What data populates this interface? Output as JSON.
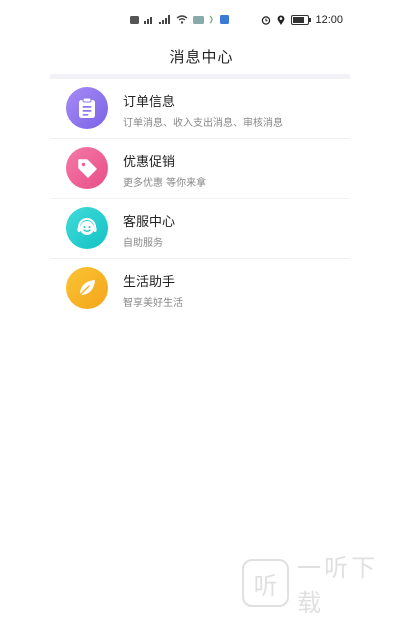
{
  "status_bar": {
    "left_icons": [
      "sim-badge-icon",
      "signal-4g-icon",
      "signal-bars-icon",
      "wifi-icon",
      "data-badge-icon",
      "nfc-icon",
      "app-badge-icon"
    ],
    "right_icons": [
      "alarm-icon",
      "location-icon",
      "battery-icon"
    ],
    "battery_level": 0.85,
    "time": "12:00"
  },
  "header": {
    "title": "消息中心"
  },
  "items": [
    {
      "title": "订单信息",
      "subtitle": "订单消息、收入支出消息、审核消息",
      "icon": "clipboard-icon",
      "color_from": "#a58bf5",
      "color_to": "#7b63e6"
    },
    {
      "title": "优惠促销",
      "subtitle": "更多优惠  等你来拿",
      "icon": "tag-icon",
      "color_from": "#f47aa7",
      "color_to": "#e84d89"
    },
    {
      "title": "客服中心",
      "subtitle": "自助服务",
      "icon": "headset-icon",
      "color_from": "#3fdcd9",
      "color_to": "#15c1c4"
    },
    {
      "title": "生活助手",
      "subtitle": "智享美好生活",
      "icon": "leaf-icon",
      "color_from": "#fbc434",
      "color_to": "#f4a41a"
    }
  ],
  "watermark": {
    "logo_char": "听",
    "text": "一听下载"
  }
}
